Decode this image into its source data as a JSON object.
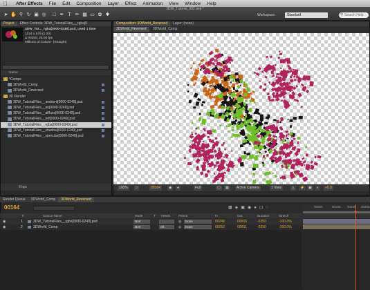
{
  "menubar": {
    "app": "After Effects",
    "items": [
      "File",
      "Edit",
      "Composition",
      "Layer",
      "Effect",
      "Animation",
      "View",
      "Window",
      "Help"
    ]
  },
  "toolbar": {
    "file_title": "3DW_Tutorial_002.aep *",
    "workspace_label": "Workspace:",
    "workspace_value": "Standard",
    "search_placeholder": "Search Help"
  },
  "project_panel": {
    "tabs": [
      "Project",
      "Effect Controls: 3DW_TutorialFiles_._rgba[0"
    ],
    "selected_name": "3DW_Tut..._rgba[0000-0249].psd",
    "used_count": ", used 1 time",
    "info_lines": [
      "1024 x 576 (1.00)",
      "Δ 00250, 25.00 fps",
      "Millions of Colors+ (Straight)"
    ],
    "column_name": "Name",
    "rows": [
      {
        "label": "*Comps",
        "type": "folder",
        "indent": 0
      },
      {
        "label": "3DWorld_Comp",
        "type": "comp",
        "indent": 1
      },
      {
        "label": "3DWorld_Reversed",
        "type": "comp",
        "indent": 1
      },
      {
        "label": "3D Render",
        "type": "folder",
        "indent": 0
      },
      {
        "label": "3DW_TutorialFiles__ambient[0000-0249].psd",
        "type": "file",
        "indent": 1
      },
      {
        "label": "3DW_TutorialFiles__ao[0000-0249].psd",
        "type": "file",
        "indent": 1
      },
      {
        "label": "3DW_TutorialFiles__diffuse[0000-0249].psd",
        "type": "file",
        "indent": 1
      },
      {
        "label": "3DW_TutorialFiles__refl[0000-0249].psd",
        "type": "file",
        "indent": 1
      },
      {
        "label": "3DW_TutorialFiles__rgba[0000-0249].psd",
        "type": "file",
        "indent": 1,
        "selected": true
      },
      {
        "label": "3DW_TutorialFiles__shadow[0000-0249].psd",
        "type": "file",
        "indent": 1
      },
      {
        "label": "3DW_TutorialFiles__specular[0000-0249].psd",
        "type": "file",
        "indent": 1
      }
    ],
    "bpc": "8 bpc"
  },
  "comp_panel": {
    "tabs": [
      "Composition: 3DWorld_Reversed",
      "Layer: (none)"
    ],
    "sub_tabs": [
      "3DWorld_Reversed",
      "3DWorld_Comp"
    ],
    "zoom": "100%",
    "timecode": "00164",
    "resolution": "Full",
    "camera": "Active Camera",
    "views": "1 View",
    "exposure": "+0.0"
  },
  "timeline": {
    "tabs": [
      "Render Queue",
      "3DWorld_Comp",
      "3DWorld_Reversed"
    ],
    "current_time": "00164",
    "columns": [
      "#",
      "Source Name",
      "Mode",
      "T",
      "TrkMat",
      "Parent",
      "In",
      "Out",
      "Duration",
      "Stretch"
    ],
    "ruler_labels": [
      "00050",
      "00100",
      "00150",
      "00200"
    ],
    "layers": [
      {
        "num": "1",
        "name": "3DW_TutorialFiles__rgba[0000-0249].psd",
        "mode": "Norr",
        "trkmat": "",
        "parent": "None",
        "in": "00249",
        "out": "00000",
        "duration": "-0250",
        "stretch": "-100.0%"
      },
      {
        "num": "2",
        "name": "3DWorld_Comp",
        "mode": "Norr",
        "trkmat": "Alt",
        "parent": "None",
        "in": "00250",
        "out": "00001",
        "duration": "-0250",
        "stretch": "-100.0%"
      }
    ]
  },
  "colors": {
    "accent_orange": "#e8a23a",
    "cti_red": "#e05a2a",
    "render_orange": "#c9661a",
    "render_magenta": "#b0235c",
    "render_black": "#151515",
    "render_green": "#6fbf2a"
  }
}
